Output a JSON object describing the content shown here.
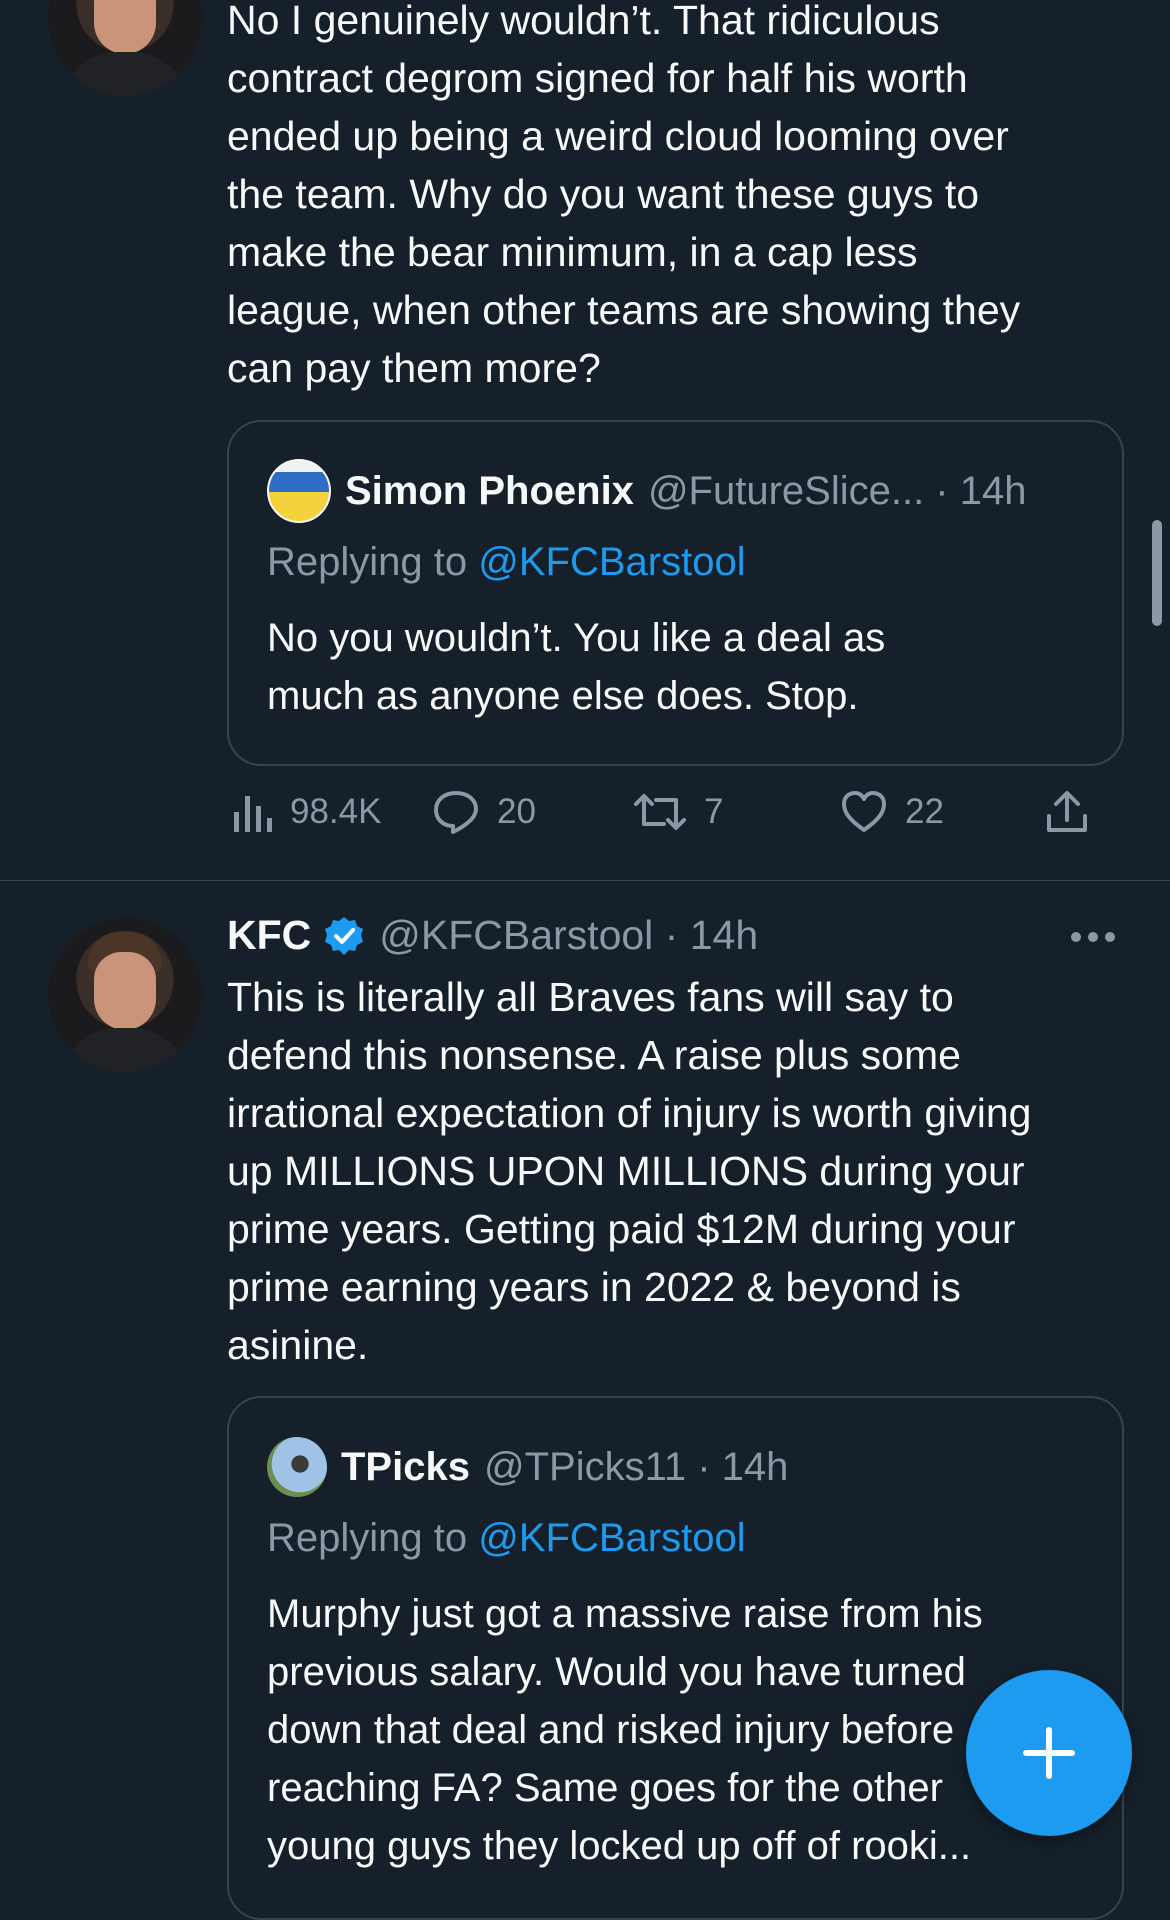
{
  "colors": {
    "background": "#15202b",
    "accent": "#1d9bf0",
    "secondary_text": "#8b98a5",
    "border": "#38444d"
  },
  "tweet1": {
    "text": "No I genuinely wouldn’t. That ridiculous\ncontract degrom signed for half his worth\nended up being a weird cloud looming over\nthe team. Why do you want these guys to\nmake the bear minimum, in a cap less\nleague, when other teams are showing they\ncan pay them more?",
    "quote": {
      "name": "Simon Phoenix",
      "handle_time": "@FutureSlice... · 14h",
      "replying_prefix": "Replying to ",
      "replying_handle": "@KFCBarstool",
      "text": "No you wouldn’t. You like a deal as\nmuch as anyone else does. Stop."
    },
    "stats": {
      "views": "98.4K",
      "replies": "20",
      "retweets": "7",
      "likes": "22"
    }
  },
  "tweet2": {
    "name": "KFC",
    "handle_time": "@KFCBarstool · 14h",
    "more_icon": "ellipsis-icon",
    "text": "This is literally all Braves fans will say to\ndefend this nonsense. A raise plus some\nirrational expectation of injury is worth giving\nup MILLIONS UPON MILLIONS during your\nprime years. Getting paid $12M during your\nprime earning years in 2022 & beyond is\nasinine.",
    "quote": {
      "name": "TPicks",
      "handle_time": "@TPicks11 · 14h",
      "replying_prefix": "Replying to ",
      "replying_handle": "@KFCBarstool",
      "text": "Murphy just got a massive raise from his\nprevious salary. Would you have turned\ndown that deal and risked injury before\nreaching FA? Same goes for the other\nyoung guys they locked up off of rooki..."
    }
  },
  "fab": {
    "icon": "plus-icon"
  }
}
